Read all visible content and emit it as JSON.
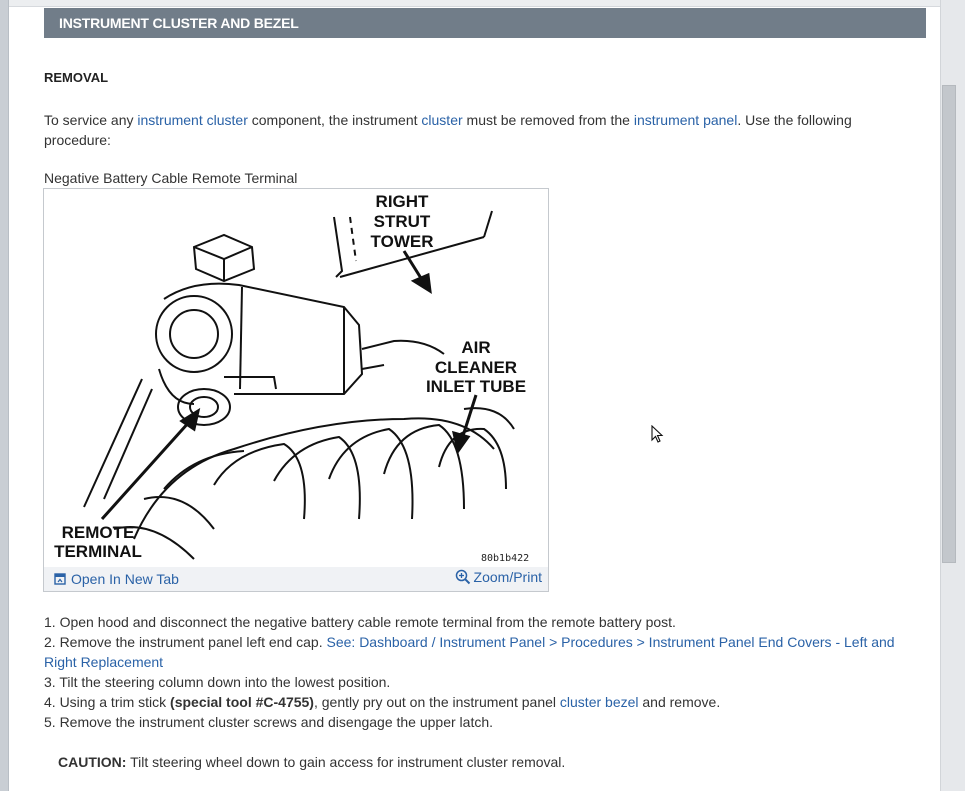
{
  "header": {
    "title": "INSTRUMENT CLUSTER AND BEZEL"
  },
  "section": {
    "heading": "REMOVAL"
  },
  "intro": {
    "t1": "To service any ",
    "l1": "instrument cluster",
    "t2": " component, the instrument ",
    "l2": "cluster",
    "t3": " must be removed from the ",
    "l3": "instrument panel",
    "t4": ". Use the following procedure:"
  },
  "figure": {
    "caption": "Negative Battery Cable Remote Terminal",
    "labels": {
      "strut": [
        "RIGHT",
        "STRUT",
        "TOWER"
      ],
      "air": [
        "AIR",
        "CLEANER",
        "INLET TUBE"
      ],
      "remote": [
        "REMOTE",
        "TERMINAL"
      ]
    },
    "id": "80b1b422",
    "open_tab": "Open In New Tab",
    "zoom": "Zoom/Print"
  },
  "steps": {
    "s1": "1. Open hood and disconnect the negative battery cable remote terminal from the remote battery post.",
    "s2_text": "2. Remove the instrument panel left end cap. ",
    "s2_link": "See: Dashboard / Instrument Panel > Procedures > Instrument Panel End Covers - Left and Right Replacement",
    "s3": "3. Tilt the steering column down into the lowest position.",
    "s4_a": "4. Using a trim stick ",
    "s4_bold": "(special tool #C-4755)",
    "s4_b": ", gently pry out on the instrument panel ",
    "s4_link": "cluster bezel",
    "s4_c": " and remove.",
    "s5": "5. Remove the instrument cluster screws and disengage the upper latch."
  },
  "caution": {
    "label": "CAUTION:",
    "text": " Tilt steering wheel down to gain access for instrument cluster removal."
  },
  "icons": {
    "open_tab": "open-in-new-tab-icon",
    "zoom": "zoom-in-icon",
    "cursor": "mouse-pointer-icon"
  }
}
